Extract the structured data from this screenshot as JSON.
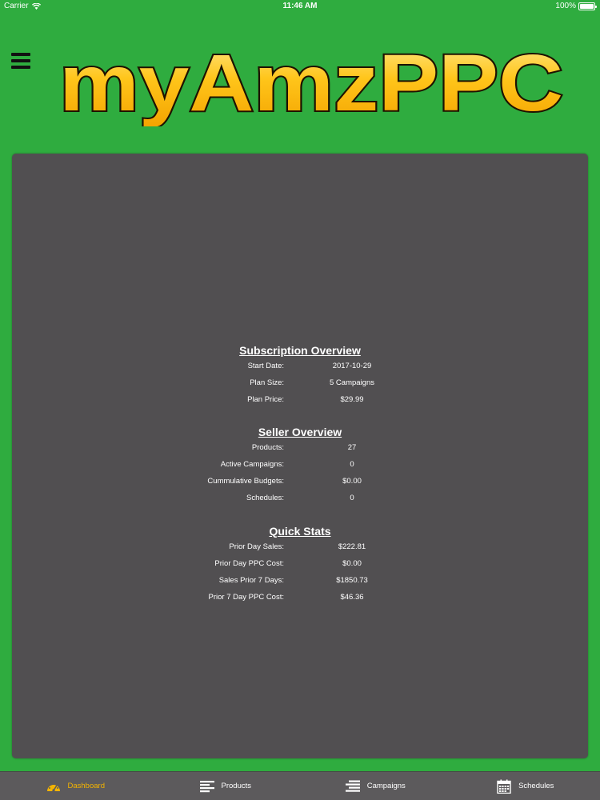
{
  "status_bar": {
    "carrier": "Carrier",
    "time": "11:46 AM",
    "battery": "100%"
  },
  "header": {
    "logo_text": "myAmzPPC",
    "menu_icon": "hamburger-menu-icon"
  },
  "colors": {
    "background": "#2fac3f",
    "panel": "#514f51",
    "tab_bar": "#5c5a5c",
    "accent": "#f4b400"
  },
  "subscription": {
    "title": "Subscription Overview",
    "rows": [
      {
        "label": "Start Date:",
        "value": "2017-10-29"
      },
      {
        "label": "Plan Size:",
        "value": "5 Campaigns"
      },
      {
        "label": "Plan Price:",
        "value": "$29.99"
      }
    ]
  },
  "seller": {
    "title": "Seller Overview",
    "rows": [
      {
        "label": "Products:",
        "value": "27"
      },
      {
        "label": "Active Campaigns:",
        "value": "0"
      },
      {
        "label": "Cummulative Budgets:",
        "value": "$0.00"
      },
      {
        "label": "Schedules:",
        "value": "0"
      }
    ]
  },
  "quick_stats": {
    "title": "Quick Stats",
    "rows": [
      {
        "label": "Prior Day Sales:",
        "value": "$222.81"
      },
      {
        "label": "Prior Day PPC Cost:",
        "value": "$0.00"
      },
      {
        "label": "Sales Prior 7 Days:",
        "value": "$1850.73"
      },
      {
        "label": "Prior 7 Day PPC Cost:",
        "value": "$46.36"
      }
    ]
  },
  "tabs": [
    {
      "label": "Dashboard",
      "icon": "speedometer-icon",
      "active": true
    },
    {
      "label": "Products",
      "icon": "list-icon",
      "active": false
    },
    {
      "label": "Campaigns",
      "icon": "stacked-list-icon",
      "active": false
    },
    {
      "label": "Schedules",
      "icon": "calendar-icon",
      "active": false
    }
  ]
}
